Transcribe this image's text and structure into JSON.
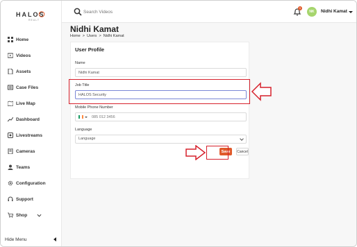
{
  "logo": {
    "text": "HALOS",
    "sub": "REALT"
  },
  "search": {
    "placeholder": "Search Videos"
  },
  "notifications": {
    "count": "9"
  },
  "user": {
    "initials": "NK",
    "name": "Nidhi Kamat"
  },
  "sidebar": {
    "items": [
      {
        "label": "Home",
        "icon": "grid-icon"
      },
      {
        "label": "Videos",
        "icon": "video-icon"
      },
      {
        "label": "Assets",
        "icon": "file-icon"
      },
      {
        "label": "Case Files",
        "icon": "folder-icon"
      },
      {
        "label": "Live Map",
        "icon": "map-icon"
      },
      {
        "label": "Dashboard",
        "icon": "chart-icon"
      },
      {
        "label": "Livestreams",
        "icon": "livestream-icon"
      },
      {
        "label": "Cameras",
        "icon": "camera-icon"
      },
      {
        "label": "Teams",
        "icon": "user-icon"
      },
      {
        "label": "Configuration",
        "icon": "gear-icon"
      },
      {
        "label": "Support",
        "icon": "headset-icon"
      },
      {
        "label": "Shop",
        "icon": "cart-icon"
      }
    ],
    "hide_menu": "Hide Menu"
  },
  "page": {
    "title": "Nidhi Kamat",
    "breadcrumb": [
      "Home",
      "Users",
      "Nidhi Kamat"
    ]
  },
  "profile": {
    "section_title": "User Profile",
    "name_label": "Name",
    "name_value": "Nidhi Kamat",
    "job_label": "Job Title",
    "job_value": "HALOS Security",
    "phone_label": "Mobile Phone Number",
    "phone_placeholder": "085 012 3456",
    "language_label": "Language",
    "language_value": "Language",
    "save_label": "Save",
    "cancel_label": "Cancel"
  },
  "colors": {
    "accent": "#e05a2b",
    "highlight": "#d6202b",
    "avatar": "#a6d56d"
  }
}
